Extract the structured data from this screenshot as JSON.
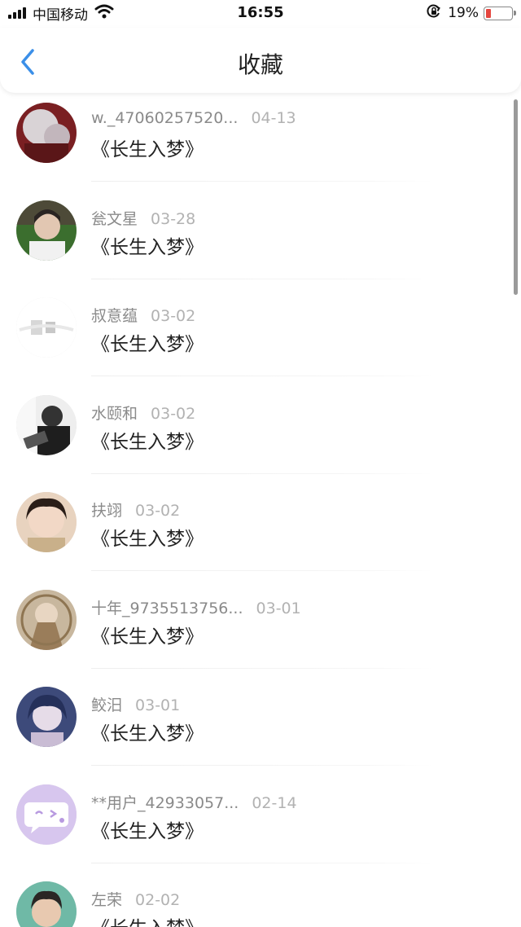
{
  "status_bar": {
    "carrier": "中国移动",
    "time": "16:55",
    "battery_percent": "19%",
    "battery_level": 0.19,
    "icons": [
      "signal-icon",
      "wifi-icon",
      "orientation-lock-icon",
      "battery-icon"
    ]
  },
  "nav": {
    "title": "收藏",
    "back_icon": "chevron-left-icon",
    "accent": "#3b8fe8"
  },
  "favorites": [
    {
      "user": "w._47060257520...",
      "date": "04-13",
      "title": "《长生入梦》"
    },
    {
      "user": "瓮文星",
      "date": "03-28",
      "title": "《长生入梦》"
    },
    {
      "user": "叔意蕴",
      "date": "03-02",
      "title": "《长生入梦》"
    },
    {
      "user": "水颐和",
      "date": "03-02",
      "title": "《长生入梦》"
    },
    {
      "user": "扶翊",
      "date": "03-02",
      "title": "《长生入梦》"
    },
    {
      "user": "十年_9735513756...",
      "date": "03-01",
      "title": "《长生入梦》"
    },
    {
      "user": "鲛汨",
      "date": "03-01",
      "title": "《长生入梦》"
    },
    {
      "user": "**用户_42933057...",
      "date": "02-14",
      "title": "《长生入梦》"
    },
    {
      "user": "左荣",
      "date": "02-02",
      "title": "《长生入梦》"
    }
  ]
}
